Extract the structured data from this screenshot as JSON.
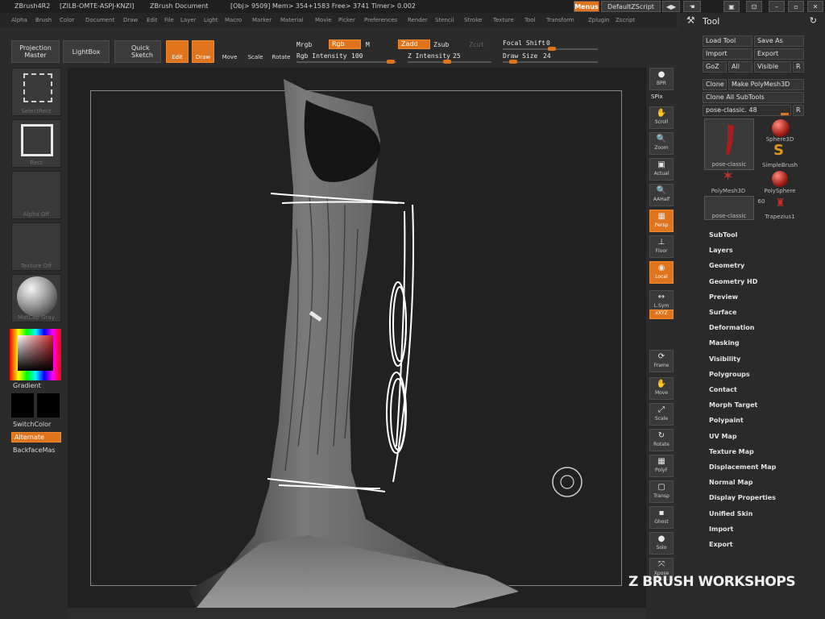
{
  "titlebar": {
    "app": "ZBrush4R2",
    "license": "[ZILB-OMTE-ASPJ-KNZI]",
    "document": "ZBrush Document",
    "stats": "[Obj> 9509] Mem> 354+1583 Free> 3741 Timer> 0.002",
    "menus_label": "Menus",
    "script_label": "DefaultZScript"
  },
  "menubar": [
    "Alpha",
    "Brush",
    "Color",
    "Document",
    "Draw",
    "Edit",
    "File",
    "Layer",
    "Light",
    "Macro",
    "Marker",
    "Material",
    "Movie",
    "Picker",
    "Preferences",
    "Render",
    "Stencil",
    "Stroke",
    "Texture",
    "Tool",
    "Transform",
    "Zplugin",
    "Zscript"
  ],
  "shelf": {
    "projection_master": "Projection Master",
    "lightbox": "LightBox",
    "quick_sketch": "Quick Sketch",
    "edit": "Edit",
    "draw": "Draw",
    "move": "Move",
    "scale": "Scale",
    "rotate": "Rotate",
    "mrgb": "Mrgb",
    "rgb": "Rgb",
    "m": "M",
    "zadd": "Zadd",
    "zsub": "Zsub",
    "zcut": "Zcut",
    "rgb_intensity_label": "Rgb Intensity",
    "rgb_intensity": "100",
    "z_intensity_label": "Z Intensity",
    "z_intensity": "25",
    "focal_shift_label": "Focal Shift",
    "focal_shift": "0",
    "draw_size_label": "Draw Size",
    "draw_size": "24"
  },
  "left": {
    "brush_caption": "SelectRect",
    "stroke_caption": "Rect",
    "alpha_caption": "Alpha Off",
    "texture_caption": "Texture Off",
    "material_caption": "MatCap Gray",
    "gradient": "Gradient",
    "switch_color": "SwitchColor",
    "alternate": "Alternate",
    "backface": "BackfaceMas"
  },
  "right": [
    {
      "icon": "●",
      "label": "BPR"
    },
    {
      "icon": "✋",
      "label": "Scroll"
    },
    {
      "icon": "🔍",
      "label": "Zoom"
    },
    {
      "icon": "▣",
      "label": "Actual"
    },
    {
      "icon": "🔍",
      "label": "AAHalf"
    },
    {
      "icon": "▦",
      "label": "Persp"
    },
    {
      "icon": "⊥",
      "label": "Floor"
    },
    {
      "icon": "◉",
      "label": "Local"
    },
    {
      "icon": "↔",
      "label": "L.Sym"
    },
    {
      "icon": "⟲",
      "label": "xXYZ"
    },
    {
      "icon": "⟳",
      "label": "Frame"
    },
    {
      "icon": "✋",
      "label": "Move"
    },
    {
      "icon": "⤢",
      "label": "Scale"
    },
    {
      "icon": "↻",
      "label": "Rotate"
    },
    {
      "icon": "▦",
      "label": "PolyF"
    },
    {
      "icon": "▢",
      "label": "Transp"
    },
    {
      "icon": "▪",
      "label": "Ghost"
    },
    {
      "icon": "●",
      "label": "Solo"
    },
    {
      "icon": "⤧",
      "label": "Xpose"
    }
  ],
  "spix": "SPix",
  "tool": {
    "title": "Tool",
    "load": "Load Tool",
    "save": "Save As",
    "import": "Import",
    "export": "Export",
    "goz": "GoZ",
    "all": "All",
    "visible": "Visible",
    "r": "R",
    "clone": "Clone",
    "make_polymesh": "Make PolyMesh3D",
    "clone_all": "Clone All SubTools",
    "current": "pose-classic. 48",
    "thumbs": [
      "pose-classic",
      "Sphere3D",
      "SimpleBrush",
      "PolyMesh3D",
      "PolySphere",
      "pose-classic",
      "Trapezius1"
    ],
    "thumb_count": "60",
    "sections": [
      "SubTool",
      "Layers",
      "Geometry",
      "Geometry HD",
      "Preview",
      "Surface",
      "Deformation",
      "Masking",
      "Visibility",
      "Polygroups",
      "Contact",
      "Morph Target",
      "Polypaint",
      "UV Map",
      "Texture Map",
      "Displacement Map",
      "Normal Map",
      "Display Properties",
      "Unified Skin",
      "Import",
      "Export"
    ]
  },
  "watermark": "Z BRUSH WORKSHOPS"
}
